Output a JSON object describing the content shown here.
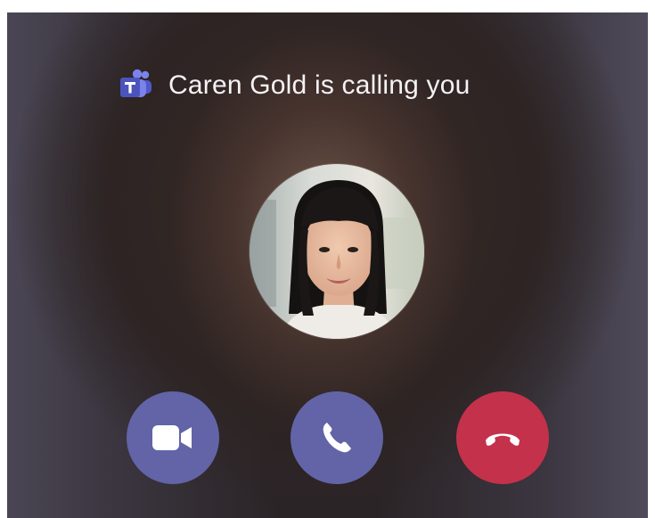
{
  "call": {
    "title": "Caren Gold is calling you",
    "app_icon": "microsoft-teams-icon"
  },
  "avatar": {
    "description_icon": "caller-photo"
  },
  "actions": [
    {
      "name": "accept-with-video",
      "icon": "video-camera-icon",
      "color": "#6264a7"
    },
    {
      "name": "accept-with-audio",
      "icon": "phone-icon",
      "color": "#6264a7"
    },
    {
      "name": "decline",
      "icon": "hang-up-icon",
      "color": "#c4314b"
    }
  ],
  "colors": {
    "accent": "#6264a7",
    "decline": "#c4314b",
    "text": "#f4f2f4"
  }
}
